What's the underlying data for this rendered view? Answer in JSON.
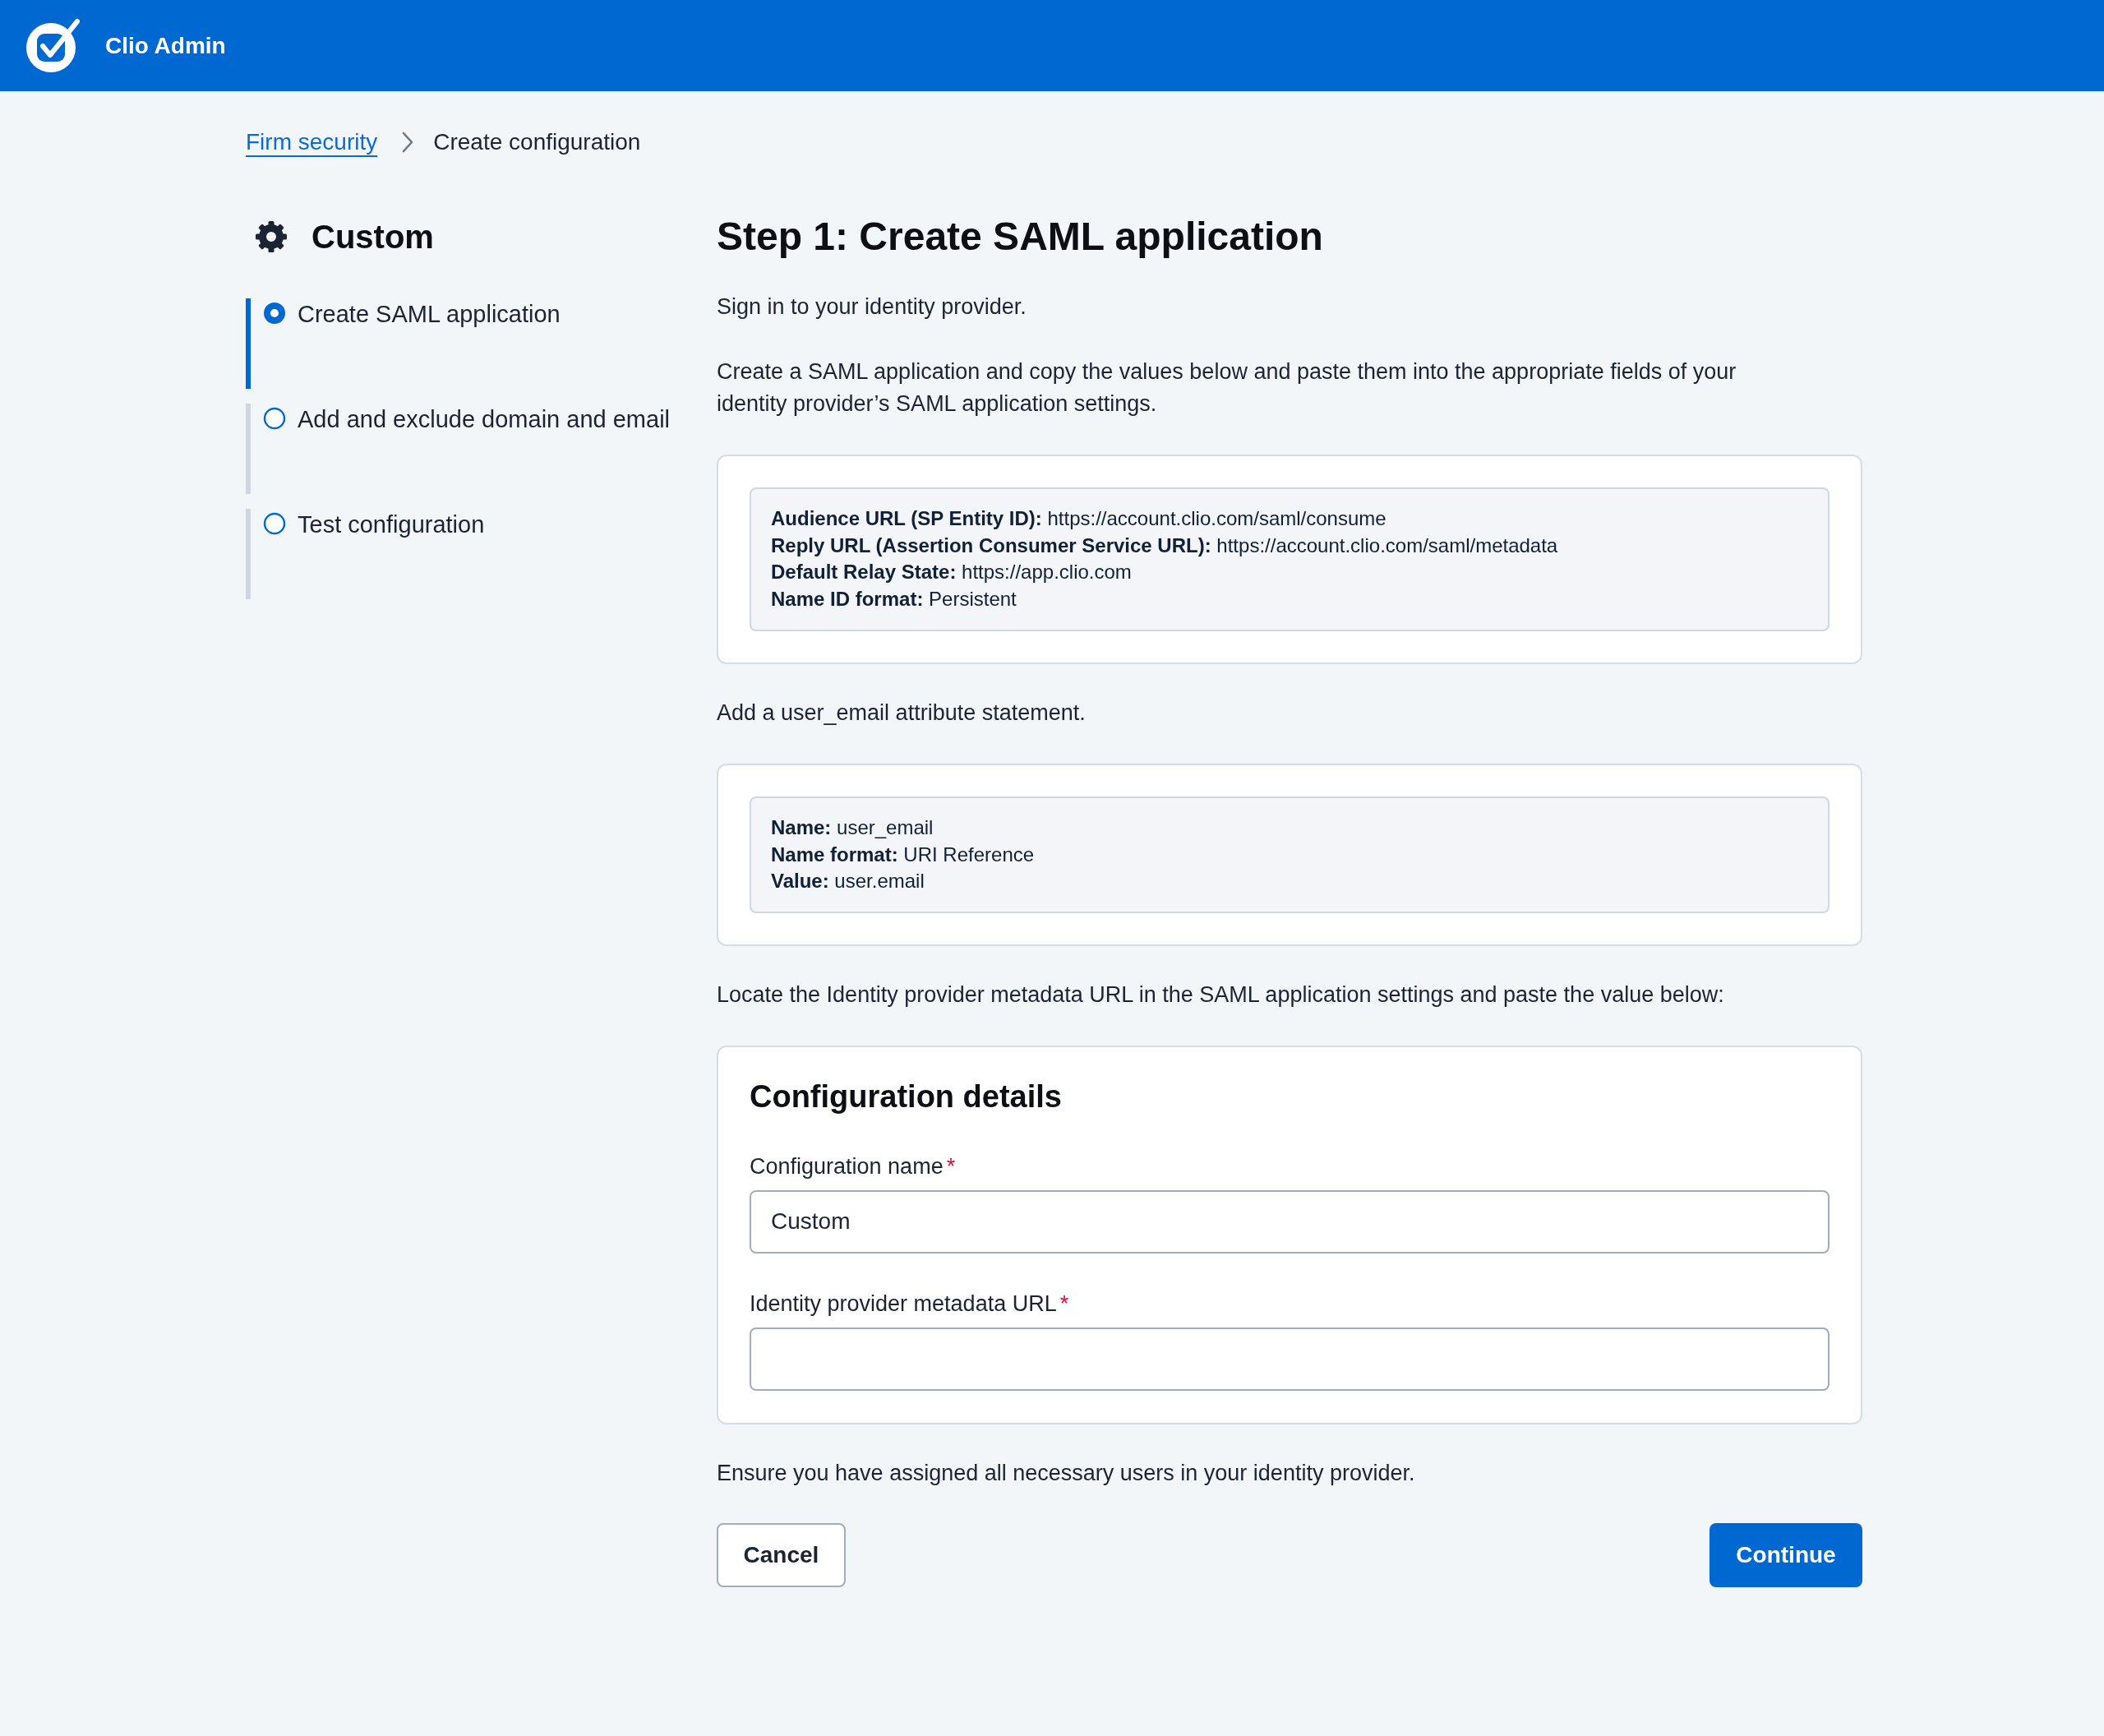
{
  "app_bar": {
    "title": "Clio Admin"
  },
  "breadcrumb": [
    {
      "label": "Firm security",
      "kind": "link"
    },
    {
      "label": "Create configuration",
      "kind": "current"
    }
  ],
  "sidebar": {
    "title": "Custom",
    "steps": [
      {
        "label": "Create SAML application",
        "selected": true
      },
      {
        "label": "Add and exclude domain and email",
        "selected": false
      },
      {
        "label": "Test configuration",
        "selected": false
      }
    ]
  },
  "main": {
    "heading": "Step 1: Create SAML application",
    "intro": "Sign in to your identity provider.",
    "instructions": "Create a SAML application and copy the values below and paste them into the appropriate fields of your identity provider’s SAML application settings.",
    "sp_settings": [
      "**Audience URL (SP Entity ID):** https://account.clio.com/saml/consume",
      "**Reply URL (Assertion Consumer Service URL):** https://account.clio.com/saml/metadata",
      "**Default Relay State:** https://app.clio.com",
      "**Name ID format:** Persistent"
    ],
    "attribute_intro": "Add a user_email attribute statement.",
    "attribute_settings": [
      "**Name:** user_email",
      "**Name format:** URI Reference",
      "**Value:** user.email"
    ],
    "metadata_intro": "Locate the Identity provider metadata URL in the SAML application settings and paste the value below:",
    "config_form": {
      "title": "Configuration details",
      "fields": [
        {
          "label": "Configuration name",
          "required_mark": "*",
          "value": "Custom"
        },
        {
          "label": "Identity provider metadata URL",
          "required_mark": "*"
        }
      ]
    },
    "footer_note": "Ensure you have assigned all necessary users in your identity provider.",
    "buttons": [
      {
        "label": "Cancel",
        "kind": "secondary"
      },
      {
        "label": "Continue",
        "kind": "primary"
      }
    ]
  }
}
